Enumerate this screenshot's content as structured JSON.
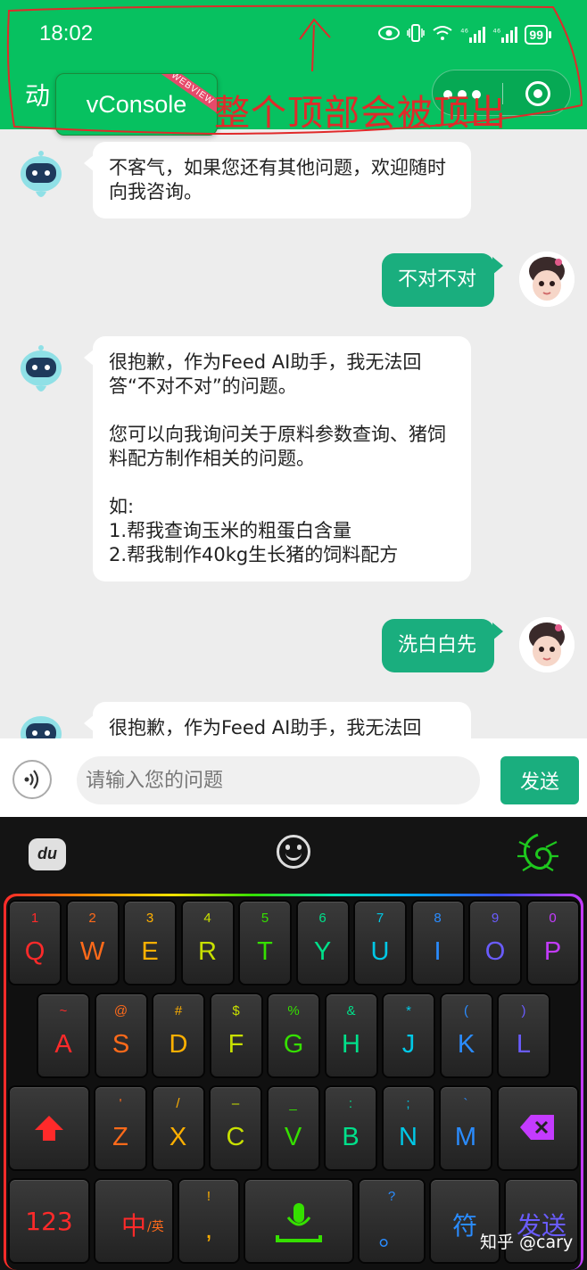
{
  "status_bar": {
    "time": "18:02",
    "network_1": "⁴⁶",
    "network_2": "⁴⁶",
    "battery": "99"
  },
  "nav": {
    "title": "动",
    "vconsole_label": "vConsole",
    "vconsole_badge": "WEBVIEW"
  },
  "annotation": {
    "text": "整个顶部会被顶出",
    "color": "#e02a2a"
  },
  "messages": [
    {
      "role": "bot",
      "text": "不客气，如果您还有其他问题，欢迎随时向我咨询。"
    },
    {
      "role": "user",
      "text": "不对不对"
    },
    {
      "role": "bot",
      "lines": [
        "很抱歉，作为Feed AI助手，我无法回答“不对不对”的问题。",
        "",
        "您可以向我询问关于原料参数查询、猪饲料配方制作相关的问题。",
        "",
        "如:",
        "1.帮我查询玉米的粗蛋白含量",
        "2.帮我制作40kg生长猪的饲料配方"
      ]
    },
    {
      "role": "user",
      "text": "洗白白先"
    },
    {
      "role": "bot",
      "text": "很抱歉，作为Feed AI助手，我无法回"
    }
  ],
  "input": {
    "placeholder": "请输入您的问题",
    "value": "",
    "send_label": "发送"
  },
  "keyboard": {
    "logo": "du",
    "row1": [
      {
        "sec": "1",
        "pri": "Q"
      },
      {
        "sec": "2",
        "pri": "W"
      },
      {
        "sec": "3",
        "pri": "E"
      },
      {
        "sec": "4",
        "pri": "R"
      },
      {
        "sec": "5",
        "pri": "T"
      },
      {
        "sec": "6",
        "pri": "Y"
      },
      {
        "sec": "7",
        "pri": "U"
      },
      {
        "sec": "8",
        "pri": "I"
      },
      {
        "sec": "9",
        "pri": "O"
      },
      {
        "sec": "0",
        "pri": "P"
      }
    ],
    "row2": [
      {
        "sec": "~",
        "pri": "A"
      },
      {
        "sec": "@",
        "pri": "S"
      },
      {
        "sec": "#",
        "pri": "D"
      },
      {
        "sec": "$",
        "pri": "F"
      },
      {
        "sec": "%",
        "pri": "G"
      },
      {
        "sec": "&",
        "pri": "H"
      },
      {
        "sec": "*",
        "pri": "J"
      },
      {
        "sec": "(",
        "pri": "K"
      },
      {
        "sec": ")",
        "pri": "L"
      }
    ],
    "row3": [
      {
        "sec": "'",
        "pri": "Z"
      },
      {
        "sec": "/",
        "pri": "X"
      },
      {
        "sec": "–",
        "pri": "C"
      },
      {
        "sec": "_",
        "pri": "V"
      },
      {
        "sec": ":",
        "pri": "B"
      },
      {
        "sec": ";",
        "pri": "N"
      },
      {
        "sec": "`",
        "pri": "M"
      }
    ],
    "num_key": "123",
    "lang_key": "中",
    "lang_sub": "/英",
    "punct_sec": "!",
    "punct_pri": ",",
    "qmark_sec": "?",
    "qmark_pri": "。",
    "symbol_key": "符",
    "send_key": "发送",
    "rainbow": [
      "#ff2a2a",
      "#ff6a1a",
      "#ffb000",
      "#c8e000",
      "#35e000",
      "#00e08a",
      "#00c8e6",
      "#2a8cff",
      "#6a5cff",
      "#c43bff"
    ]
  },
  "watermark": "知乎 @cary"
}
